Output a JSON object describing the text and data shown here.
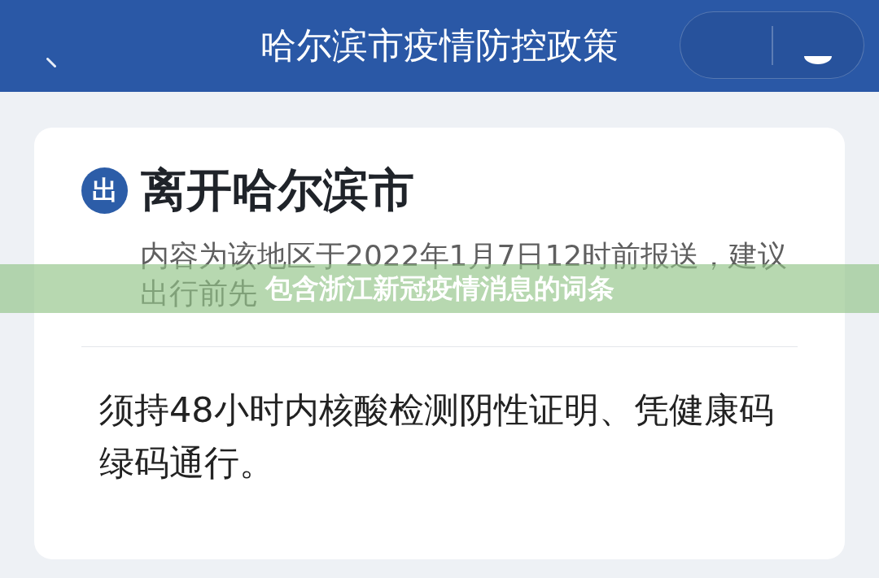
{
  "top_bar": {
    "title": "哈尔滨市疫情防控政策"
  },
  "card": {
    "badge": "出",
    "title": "离开哈尔滨市",
    "notice_lines": [
      "内容为该地区于2022年1月7日12时前报送，建议",
      "出行前先"
    ],
    "policy": "须持48小时内核酸检测阴性证明、凭健康码绿码通行。"
  },
  "overlay_banner": {
    "text": "包含浙江新冠疫情消息的词条"
  }
}
